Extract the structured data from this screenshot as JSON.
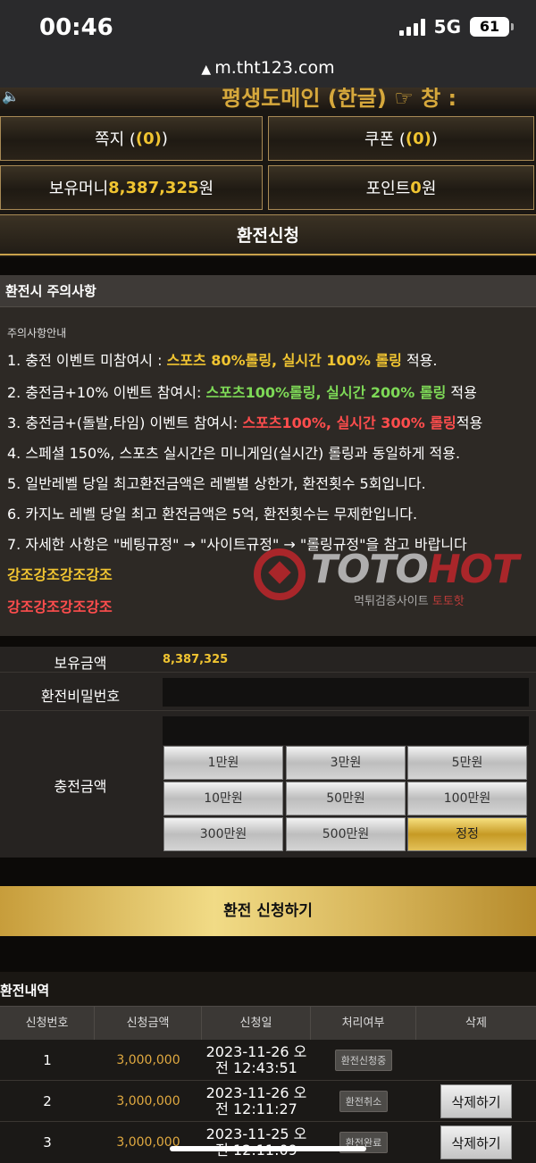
{
  "status_bar": {
    "time": "00:46",
    "network": "5G",
    "battery": "61"
  },
  "browser": {
    "url": "m.tht123.com"
  },
  "marquee": {
    "text": "평생도메인 (한글) ☞ 창 :"
  },
  "top_panels": {
    "memo": {
      "label": "쪽지 ( ",
      "count": "(0)",
      "suffix": " )"
    },
    "coupon": {
      "label": "쿠폰 ( ",
      "count": "(0)",
      "suffix": " )"
    },
    "money": {
      "label": "보유머니 ",
      "value": "8,387,325",
      "unit": " 원"
    },
    "point": {
      "label": "포인트 ",
      "value": "0",
      "unit": " 원"
    }
  },
  "withdraw_title": "환전신청",
  "notice": {
    "header": "환전시 주의사항",
    "subtitle": "주의사항안내",
    "line1": {
      "pre": "1. 충전 이벤트 미참여시 : ",
      "hl": "스포츠 80%롤링, 실시간 100% 롤링",
      "post": " 적용."
    },
    "line2": {
      "pre": "2. 충전금+10% 이벤트 참여시: ",
      "hl": "스포츠100%롤링, 실시간 200% 롤링",
      "post": " 적용"
    },
    "line3": {
      "pre": "3. 충전금+(돌발,타임) 이벤트 참여시: ",
      "hl": "스포츠100%, 실시간 300% 롤링",
      "post": "적용"
    },
    "line4": "4. 스페셜 150%, 스포츠 실시간은 미니게임(실시간) 롤링과 동일하게 적용.",
    "line5": "5. 일반레벨 당일 최고환전금액은 레벨별 상한가, 환전횟수 5회입니다.",
    "line6": "6. 카지노 레벨 당일 최고 환전금액은 5억, 환전횟수는 무제한입니다.",
    "line7": "7. 자세한 사항은 \"베팅규정\" → \"사이트규정\" → \"롤링규정\"을 참고 바랍니다",
    "emph_gold": "강조강조강조강조",
    "emph_red": "강조강조강조강조"
  },
  "watermark": {
    "brand_a": "TOTO",
    "brand_b": "HOT",
    "sub": "먹튀검증사이트 ",
    "sub_red": "토토핫"
  },
  "form": {
    "balance_label": "보유금액",
    "balance_value": "8,387,325",
    "password_label": "환전비밀번호",
    "amount_label": "충전금액",
    "buttons": [
      "1만원",
      "3만원",
      "5만원",
      "10만원",
      "50만원",
      "100만원",
      "300만원",
      "500만원",
      "정정"
    ]
  },
  "submit_label": "환전 신청하기",
  "history": {
    "title": "환전내역",
    "columns": [
      "신청번호",
      "신청금액",
      "신청일",
      "처리여부",
      "삭제"
    ],
    "rows": [
      {
        "no": "1",
        "amount": "3,000,000",
        "date_a": "2023-11-26 오",
        "date_b": "전 12:43:51",
        "status": "환전신청중",
        "delete": ""
      },
      {
        "no": "2",
        "amount": "3,000,000",
        "date_a": "2023-11-26 오",
        "date_b": "전 12:11:27",
        "status": "환전취소",
        "delete": "삭제하기"
      },
      {
        "no": "3",
        "amount": "3,000,000",
        "date_a": "2023-11-25 오",
        "date_b": "전 12:11:09",
        "status": "환전완료",
        "delete": "삭제하기"
      }
    ]
  }
}
